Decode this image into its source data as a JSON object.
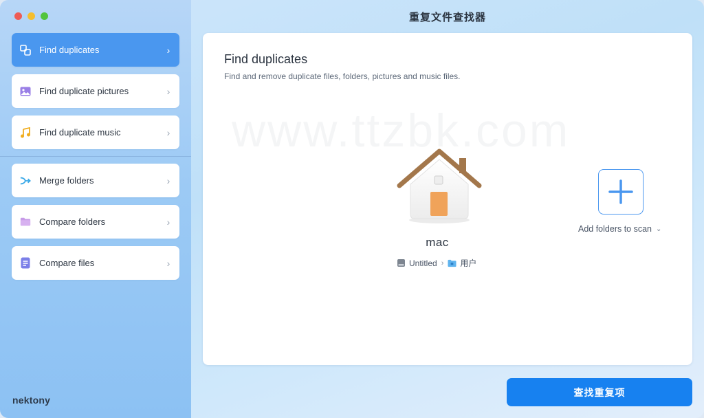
{
  "window": {
    "title": "重复文件查找器"
  },
  "sidebar": {
    "items": [
      {
        "label": "Find duplicates",
        "icon": "duplicates-icon",
        "active": true
      },
      {
        "label": "Find duplicate pictures",
        "icon": "pictures-icon"
      },
      {
        "label": "Find duplicate music",
        "icon": "music-icon"
      },
      {
        "label": "Merge folders",
        "icon": "merge-icon"
      },
      {
        "label": "Compare folders",
        "icon": "folder-icon"
      },
      {
        "label": "Compare files",
        "icon": "file-icon"
      }
    ],
    "brand": "nektony"
  },
  "main": {
    "title": "Find duplicates",
    "subtitle": "Find and remove duplicate files, folders, pictures and music files.",
    "watermark": "www.ttzbk.com",
    "folder": {
      "name": "mac",
      "path": [
        {
          "label": "Untitled",
          "icon": "disk-icon"
        },
        {
          "label": "用户",
          "icon": "folder-icon"
        }
      ]
    },
    "add_folders_label": "Add folders to scan"
  },
  "footer": {
    "scan_button": "查找重复项"
  },
  "colors": {
    "accent": "#1781f0",
    "active_item": "#4a97ef"
  }
}
